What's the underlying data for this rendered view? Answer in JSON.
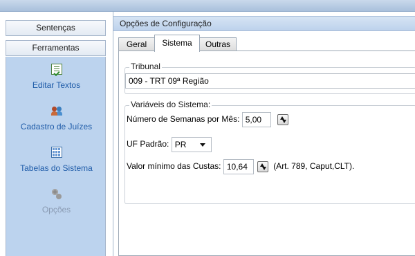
{
  "nav": {
    "sentencas_label": "Sentenças",
    "ferramentas_label": "Ferramentas"
  },
  "tools": {
    "editar_textos": "Editar Textos",
    "cadastro_juizes": "Cadastro de Juízes",
    "tabelas_sistema": "Tabelas do Sistema",
    "opcoes": "Opções"
  },
  "config": {
    "title": "Opções de Configuração",
    "tabs": [
      "Geral",
      "Sistema",
      "Outras"
    ],
    "active_tab": "Sistema",
    "tribunal": {
      "legend": "Tribunal",
      "value": "009 - TRT 09ª Região"
    },
    "variaveis": {
      "legend": "Variáveis do Sistema:",
      "semanas_label": "Número de Semanas por Mês:",
      "semanas_value": "5,00",
      "uf_label": "UF Padrão:",
      "uf_value": "PR",
      "custas_label": "Valor mínimo das Custas:",
      "custas_value": "10,64",
      "custas_note": "(Art. 789, Caput,CLT)."
    }
  },
  "icons": {
    "editar_textos": "document-check-icon",
    "cadastro_juizes": "users-icon",
    "tabelas_sistema": "table-icon",
    "opcoes": "gear-icon"
  },
  "colors": {
    "tool_pane_bg": "#bcd3ee",
    "tool_link": "#1e5ba8",
    "tool_disabled": "#8a9bb3",
    "title_bar": "#bdd2ec"
  }
}
